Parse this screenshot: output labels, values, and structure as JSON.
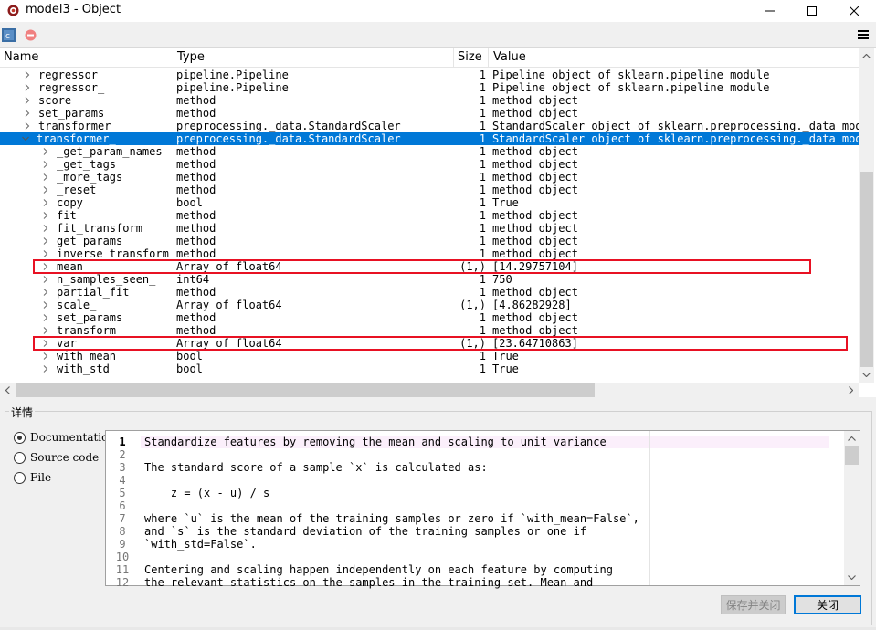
{
  "window": {
    "title": "model3 - Object",
    "minimize_icon": "minimize-icon",
    "maximize_icon": "maximize-icon",
    "close_icon": "close-icon"
  },
  "toolbar": {
    "icons": [
      "class-icon",
      "stop-icon",
      "hamburger-menu-icon"
    ]
  },
  "table": {
    "columns": [
      "Name",
      "Type",
      "Size",
      "Value"
    ],
    "rows": [
      {
        "name": "regressor",
        "indent": 1,
        "expanded": false,
        "type": "pipeline.Pipeline",
        "size": "1",
        "value": "Pipeline object of sklearn.pipeline module"
      },
      {
        "name": "regressor_",
        "indent": 1,
        "expanded": false,
        "type": "pipeline.Pipeline",
        "size": "1",
        "value": "Pipeline object of sklearn.pipeline module"
      },
      {
        "name": "score",
        "indent": 1,
        "expanded": false,
        "type": "method",
        "size": "1",
        "value": "method object"
      },
      {
        "name": "set_params",
        "indent": 1,
        "expanded": false,
        "type": "method",
        "size": "1",
        "value": "method object"
      },
      {
        "name": "transformer",
        "indent": 1,
        "expanded": false,
        "type": "preprocessing._data.StandardScaler",
        "size": "1",
        "value": "StandardScaler object of sklearn.preprocessing._data modu"
      },
      {
        "name": "transformer_",
        "indent": 1,
        "expanded": true,
        "selected": true,
        "type": "preprocessing._data.StandardScaler",
        "size": "1",
        "value": "StandardScaler object of sklearn.preprocessing._data modu"
      },
      {
        "name": "_get_param_names",
        "indent": 2,
        "expanded": false,
        "type": "method",
        "size": "1",
        "value": "method object"
      },
      {
        "name": "_get_tags",
        "indent": 2,
        "expanded": false,
        "type": "method",
        "size": "1",
        "value": "method object"
      },
      {
        "name": "_more_tags",
        "indent": 2,
        "expanded": false,
        "type": "method",
        "size": "1",
        "value": "method object"
      },
      {
        "name": "_reset",
        "indent": 2,
        "expanded": false,
        "type": "method",
        "size": "1",
        "value": "method object"
      },
      {
        "name": "copy",
        "indent": 2,
        "expanded": false,
        "type": "bool",
        "size": "1",
        "value": "True"
      },
      {
        "name": "fit",
        "indent": 2,
        "expanded": false,
        "type": "method",
        "size": "1",
        "value": "method object"
      },
      {
        "name": "fit_transform",
        "indent": 2,
        "expanded": false,
        "type": "method",
        "size": "1",
        "value": "method object"
      },
      {
        "name": "get_params",
        "indent": 2,
        "expanded": false,
        "type": "method",
        "size": "1",
        "value": "method object"
      },
      {
        "name": "inverse_transform",
        "indent": 2,
        "expanded": false,
        "type": "method",
        "size": "1",
        "value": "method object"
      },
      {
        "name": "mean_",
        "indent": 2,
        "expanded": false,
        "type": "Array of float64",
        "size": "(1,)",
        "value": "[14.29757104]",
        "highlighted": true
      },
      {
        "name": "n_samples_seen_",
        "indent": 2,
        "expanded": false,
        "type": "int64",
        "size": "1",
        "value": "750"
      },
      {
        "name": "partial_fit",
        "indent": 2,
        "expanded": false,
        "type": "method",
        "size": "1",
        "value": "method object"
      },
      {
        "name": "scale_",
        "indent": 2,
        "expanded": false,
        "type": "Array of float64",
        "size": "(1,)",
        "value": "[4.86282928]"
      },
      {
        "name": "set_params",
        "indent": 2,
        "expanded": false,
        "type": "method",
        "size": "1",
        "value": "method object"
      },
      {
        "name": "transform",
        "indent": 2,
        "expanded": false,
        "type": "method",
        "size": "1",
        "value": "method object"
      },
      {
        "name": "var_",
        "indent": 2,
        "expanded": false,
        "type": "Array of float64",
        "size": "(1,)",
        "value": "[23.64710863]",
        "highlighted": true
      },
      {
        "name": "with_mean",
        "indent": 2,
        "expanded": false,
        "type": "bool",
        "size": "1",
        "value": "True"
      },
      {
        "name": "with_std",
        "indent": 2,
        "expanded": false,
        "type": "bool",
        "size": "1",
        "value": "True"
      }
    ]
  },
  "details": {
    "label": "详情",
    "options": [
      {
        "label": "Documentation",
        "checked": true
      },
      {
        "label": "Source code",
        "checked": false
      },
      {
        "label": "File",
        "checked": false
      }
    ],
    "current_line": 1,
    "lines": [
      "Standardize features by removing the mean and scaling to unit variance",
      "",
      "The standard score of a sample `x` is calculated as:",
      "",
      "    z = (x - u) / s",
      "",
      "where `u` is the mean of the training samples or zero if `with_mean=False`,",
      "and `s` is the standard deviation of the training samples or one if",
      "`with_std=False`.",
      "",
      "Centering and scaling happen independently on each feature by computing",
      "the relevant statistics on the samples in the training set. Mean and"
    ]
  },
  "buttons": {
    "save_close": "保存并关闭",
    "close": "关闭"
  },
  "colors": {
    "selection": "#0078d7",
    "highlight_box": "#e81123",
    "current_line_bg": "#fbeffb"
  }
}
